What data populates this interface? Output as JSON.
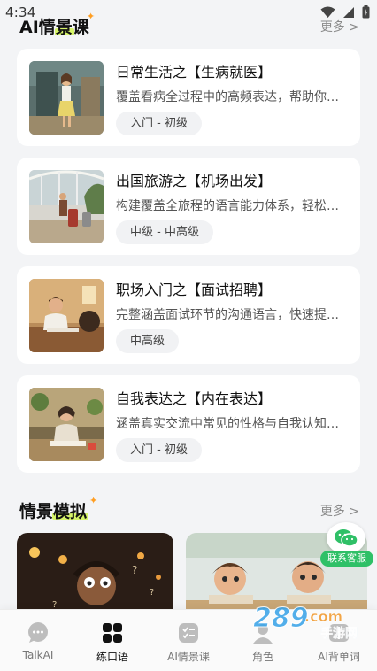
{
  "status_bar": {
    "time": "4:34",
    "icons": [
      "wifi-icon",
      "signal-icon",
      "battery-icon"
    ]
  },
  "courses_section": {
    "title_a": "AI情",
    "title_hl": "景",
    "title_b": "课",
    "more": "更多 >"
  },
  "courses": [
    {
      "title": "日常生活之【生病就医】",
      "desc": "覆盖看病全过程中的高频表达，帮助你在医院里自如沟通",
      "level": "入门 - 初级",
      "thumb": "woman-in-room"
    },
    {
      "title": "出国旅游之【机场出发】",
      "desc": "构建覆盖全旅程的语言能力体系，轻松应对机场场景",
      "level": "中级 - 中高级",
      "thumb": "airport-traveler"
    },
    {
      "title": "职场入门之【面试招聘】",
      "desc": "完整涵盖面试环节的沟通语言，快速提升求职表达",
      "level": "中高级",
      "thumb": "job-interview"
    },
    {
      "title": "自我表达之【内在表达】",
      "desc": "涵盖真实交流中常见的性格与自我认知表达方式",
      "level": "入门 - 初级",
      "thumb": "girl-writing"
    }
  ],
  "scenario_section": {
    "title_a": "情景",
    "title_hl": "模拟",
    "more": "更多 >"
  },
  "scenarios": [
    {
      "art": "dark-study-scene"
    },
    {
      "art": "classroom-kids"
    }
  ],
  "floating_service": {
    "label": "联系客服",
    "icon": "wechat-icon"
  },
  "nav": {
    "items": [
      {
        "label": "TalkAI",
        "icon": "chat-bubble-icon",
        "active": false
      },
      {
        "label": "练口语",
        "icon": "grid-icon",
        "active": true
      },
      {
        "label": "AI情景课",
        "icon": "checklist-icon",
        "active": false
      },
      {
        "label": "角色",
        "icon": "person-icon",
        "active": false
      },
      {
        "label": "AI背单词",
        "icon": "book-icon",
        "active": false
      }
    ]
  },
  "colors": {
    "accent_highlight": "#d7f56a",
    "sparkle": "#ff9e22",
    "service_green": "#2fc067",
    "background": "#f3f4f6"
  },
  "watermark": {
    "text": "289.com",
    "sub": "手游网"
  }
}
